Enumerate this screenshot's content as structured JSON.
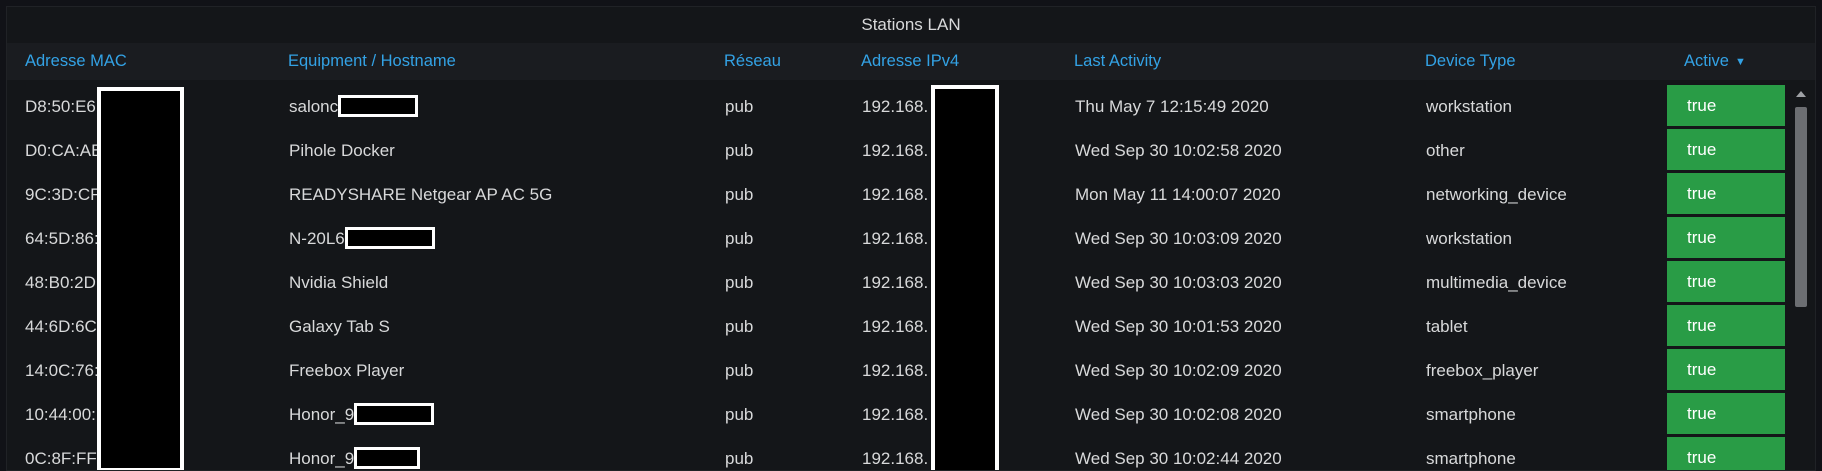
{
  "panel": {
    "title": "Stations LAN"
  },
  "columns": [
    {
      "key": "mac",
      "label": "Adresse MAC"
    },
    {
      "key": "host",
      "label": "Equipment / Hostname"
    },
    {
      "key": "net",
      "label": "Réseau"
    },
    {
      "key": "ip",
      "label": "Adresse IPv4"
    },
    {
      "key": "last",
      "label": "Last Activity"
    },
    {
      "key": "type",
      "label": "Device Type"
    },
    {
      "key": "active",
      "label": "Active"
    }
  ],
  "sort": {
    "column": "active",
    "direction": "desc",
    "icon": "chevron-down-icon"
  },
  "colors": {
    "header_text": "#33a2e5",
    "active_true_bg": "#299c46",
    "panel_bg": "#141619"
  },
  "rows": [
    {
      "mac": "D8:50:E6:",
      "host": "salonc",
      "net": "pub",
      "ip": "192.168.",
      "last": "Thu May 7 12:15:49 2020",
      "type": "workstation",
      "active": "true"
    },
    {
      "mac": "D0:CA:AB",
      "host": "Pihole Docker",
      "net": "pub",
      "ip": "192.168.",
      "last": "Wed Sep 30 10:02:58 2020",
      "type": "other",
      "active": "true"
    },
    {
      "mac": "9C:3D:CF",
      "host": "READYSHARE Netgear AP AC 5G",
      "net": "pub",
      "ip": "192.168.",
      "last": "Mon May 11 14:00:07 2020",
      "type": "networking_device",
      "active": "true"
    },
    {
      "mac": "64:5D:86:",
      "host": "N-20L6",
      "net": "pub",
      "ip": "192.168.",
      "last": "Wed Sep 30 10:03:09 2020",
      "type": "workstation",
      "active": "true"
    },
    {
      "mac": "48:B0:2D",
      "host": "Nvidia Shield",
      "net": "pub",
      "ip": "192.168.",
      "last": "Wed Sep 30 10:03:03 2020",
      "type": "multimedia_device",
      "active": "true"
    },
    {
      "mac": "44:6D:6C",
      "host": "Galaxy Tab S",
      "net": "pub",
      "ip": "192.168.",
      "last": "Wed Sep 30 10:01:53 2020",
      "type": "tablet",
      "active": "true"
    },
    {
      "mac": "14:0C:76:",
      "host": "Freebox Player",
      "net": "pub",
      "ip": "192.168.",
      "last": "Wed Sep 30 10:02:09 2020",
      "type": "freebox_player",
      "active": "true"
    },
    {
      "mac": "10:44:00:",
      "host": "Honor_9",
      "net": "pub",
      "ip": "192.168.",
      "last": "Wed Sep 30 10:02:08 2020",
      "type": "smartphone",
      "active": "true"
    },
    {
      "mac": "0C:8F:FF:",
      "host": "Honor_9",
      "net": "pub",
      "ip": "192.168.",
      "last": "Wed Sep 30 10:02:44 2020",
      "type": "smartphone",
      "active": "true"
    }
  ]
}
